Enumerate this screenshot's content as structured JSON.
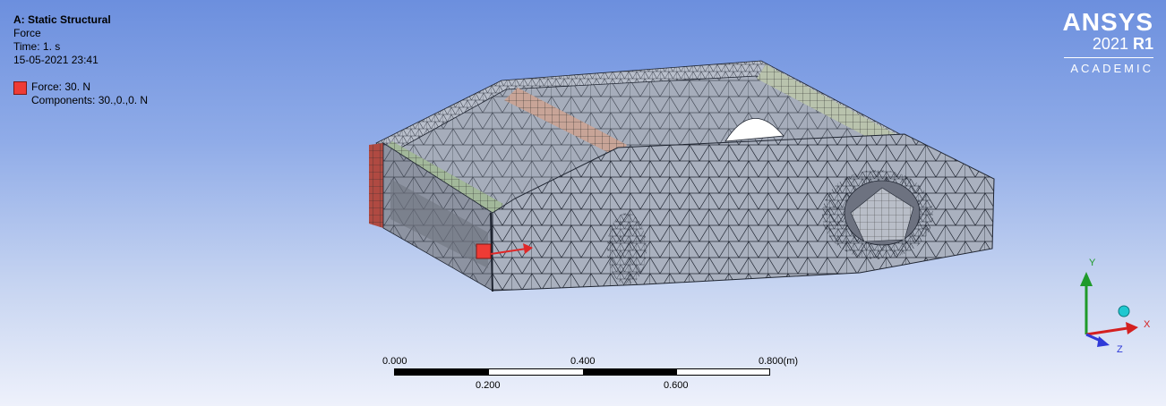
{
  "analysis": {
    "title": "A: Static Structural",
    "subtitle": "Force",
    "time": "Time: 1. s",
    "date": "15-05-2021 23:41"
  },
  "legend": {
    "item": "Force: 30. N",
    "components": "Components: 30.,0.,0. N",
    "color": "#ee3b35"
  },
  "brand": {
    "name": "ANSYS",
    "year": "2021",
    "release": "R1",
    "edition": "ACADEMIC"
  },
  "scale": {
    "top_labels": [
      "0.000",
      "0.400",
      "0.800"
    ],
    "unit": "(m)",
    "bottom_labels": [
      "0.200",
      "0.600"
    ]
  },
  "triad": {
    "x": "X",
    "y": "Y",
    "z": "Z",
    "x_color": "#d42020",
    "y_color": "#1f9a2a",
    "z_color": "#2f3ad8"
  }
}
